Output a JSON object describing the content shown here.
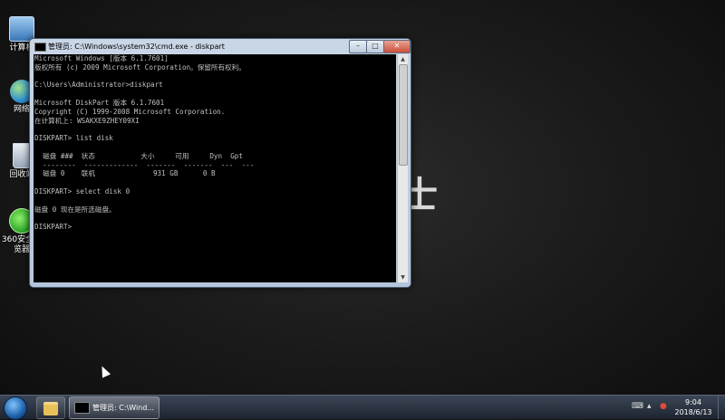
{
  "desktop": {
    "wallpaper_text": "士",
    "icons": [
      {
        "label": "计算机"
      },
      {
        "label": "网络"
      },
      {
        "label": "回收站"
      },
      {
        "label": "360安全浏览器"
      }
    ]
  },
  "window": {
    "title": "管理员: C:\\Windows\\system32\\cmd.exe - diskpart",
    "minimize_glyph": "–",
    "maximize_glyph": "□",
    "close_glyph": "✕",
    "console_lines": [
      "Microsoft Windows [版本 6.1.7601]",
      "版权所有 (c) 2009 Microsoft Corporation。保留所有权利。",
      "",
      "C:\\Users\\Administrator>diskpart",
      "",
      "Microsoft DiskPart 版本 6.1.7601",
      "Copyright (C) 1999-2008 Microsoft Corporation.",
      "在计算机上: WSAKXE9ZHEY09XI",
      "",
      "DISKPART> list disk",
      "",
      "  磁盘 ###  状态           大小     可用     Dyn  Gpt",
      "  --------  -------------  -------  -------  ---  ---",
      "  磁盘 0    联机              931 GB      0 B",
      "",
      "DISKPART> select disk 0",
      "",
      "磁盘 0 现在是所选磁盘。",
      "",
      "DISKPART>"
    ]
  },
  "taskbar": {
    "cmd_task_label": "管理员: C:\\Wind...",
    "clock_time": "9:04",
    "clock_date": "2018/6/13"
  },
  "colors": {
    "console_bg": "#000000",
    "console_text": "#c0c0c0",
    "titlebar": "#c9d6e6"
  }
}
